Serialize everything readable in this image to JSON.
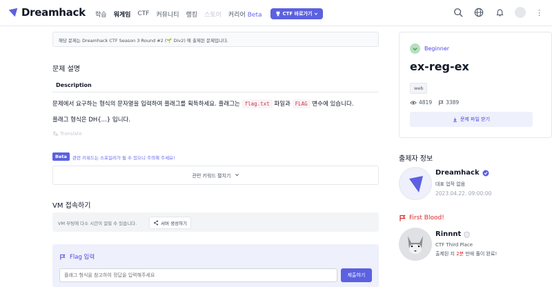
{
  "nav": {
    "logo": "Dreamhack",
    "items": [
      {
        "label": "학습",
        "state": "normal"
      },
      {
        "label": "워게임",
        "state": "active"
      },
      {
        "label": "CTF",
        "state": "normal"
      },
      {
        "label": "커뮤니티",
        "state": "normal"
      },
      {
        "label": "랭킹",
        "state": "normal"
      },
      {
        "label": "스토어",
        "state": "muted"
      }
    ],
    "career": "커리어",
    "career_beta": "Beta",
    "ctf_button": "CTF 바로가기"
  },
  "notice": "해당 문제는 Dreamhack CTF Season 3 Round #2 (🌱 Div2) 에 출제된 문제입니다.",
  "problem": {
    "section_title": "문제 설명",
    "tab": "Description",
    "line1_a": "문제에서 요구하는 형식의 문자열을 입력하여 플래그를 획득하세요. 플래그는 ",
    "code1": "flag.txt",
    "line1_b": " 파일과 ",
    "code2": "FLAG",
    "line1_c": " 변수에 있습니다.",
    "line2": "플래그 형식은 DH{...} 입니다.",
    "translate": "Translate"
  },
  "keywords": {
    "badge": "Beta",
    "note": "관련 키워드는 스포일러가 될 수 있으니 주의해 주세요!",
    "toggle": "관련 키워드 펼치기"
  },
  "vm": {
    "title": "VM 접속하기",
    "note": "VM 부팅에 다소 시간이 걸릴 수 있습니다.",
    "button": "서버 생성하기"
  },
  "flag": {
    "title": "Flag 입력",
    "placeholder": "플래그 형식을 참고하여 정답을 입력해주세요",
    "submit": "제출하기"
  },
  "challenge": {
    "level": "Beginner",
    "title": "ex-reg-ex",
    "tag": "web",
    "views": "4819",
    "solves": "3389",
    "download": "문제 파일 받기"
  },
  "author": {
    "section": "출제자 정보",
    "name": "Dreamhack",
    "role": "대표 업적 없음",
    "date": "2023.04.22. 09:00:00"
  },
  "first_blood": {
    "section": "First Blood!",
    "name": "Rinnnt",
    "achievement": "CTF Third Place",
    "time_a": "출제된 지 ",
    "time_b": "2분",
    "time_c": " 만에 풀이 완료!"
  },
  "colors": {
    "brand": "#5b61e0",
    "danger": "#dc2626"
  }
}
